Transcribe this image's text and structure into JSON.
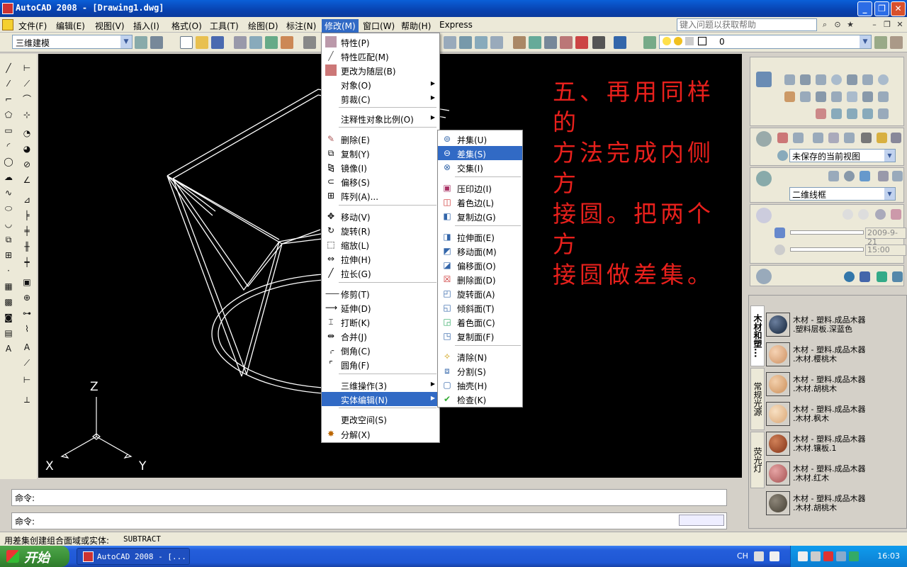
{
  "window": {
    "title": "AutoCAD 2008 - [Drawing1.dwg]",
    "buttons": {
      "minimize": "_",
      "restore": "❐",
      "close": "✕"
    }
  },
  "menubar": {
    "items": [
      "文件(F)",
      "编辑(E)",
      "视图(V)",
      "插入(I)",
      "格式(O)",
      "工具(T)",
      "绘图(D)",
      "标注(N)",
      "修改(M)",
      "窗口(W)",
      "帮助(H)",
      "Express"
    ],
    "active_index": 8,
    "help_search_placeholder": "键入问题以获取帮助"
  },
  "toolbar": {
    "workspace": "三维建模",
    "layer_value": "0"
  },
  "modify_menu": {
    "items": [
      {
        "label": "特性(P)",
        "icon": "properties-icon"
      },
      {
        "label": "特性匹配(M)",
        "icon": "match-properties-icon"
      },
      {
        "label": "更改为随层(B)",
        "icon": "change-to-bylayer-icon"
      },
      {
        "label": "对象(O)",
        "submenu": true
      },
      {
        "label": "剪裁(C)",
        "submenu": true
      },
      {
        "label": "注释性对象比例(O)",
        "submenu": true
      },
      {
        "label": "删除(E)",
        "icon": "erase-icon"
      },
      {
        "label": "复制(Y)",
        "icon": "copy-icon"
      },
      {
        "label": "镜像(I)",
        "icon": "mirror-icon"
      },
      {
        "label": "偏移(S)",
        "icon": "offset-icon"
      },
      {
        "label": "阵列(A)...",
        "icon": "array-icon"
      },
      {
        "label": "移动(V)",
        "icon": "move-icon"
      },
      {
        "label": "旋转(R)",
        "icon": "rotate-icon"
      },
      {
        "label": "缩放(L)",
        "icon": "scale-icon"
      },
      {
        "label": "拉伸(H)",
        "icon": "stretch-icon"
      },
      {
        "label": "拉长(G)",
        "icon": "lengthen-icon"
      },
      {
        "label": "修剪(T)",
        "icon": "trim-icon"
      },
      {
        "label": "延伸(D)",
        "icon": "extend-icon"
      },
      {
        "label": "打断(K)",
        "icon": "break-icon"
      },
      {
        "label": "合并(J)",
        "icon": "join-icon"
      },
      {
        "label": "倒角(C)",
        "icon": "chamfer-icon"
      },
      {
        "label": "圆角(F)",
        "icon": "fillet-icon"
      },
      {
        "label": "三维操作(3)",
        "submenu": true
      },
      {
        "label": "实体编辑(N)",
        "submenu": true,
        "highlighted": true
      },
      {
        "label": "更改空间(S)"
      },
      {
        "label": "分解(X)",
        "icon": "explode-icon"
      }
    ]
  },
  "solid_edit_menu": {
    "items": [
      {
        "label": "并集(U)",
        "icon": "union-icon"
      },
      {
        "label": "差集(S)",
        "icon": "subtract-icon",
        "highlighted": true
      },
      {
        "label": "交集(I)",
        "icon": "intersect-icon"
      },
      {
        "label": "压印边(I)",
        "icon": "imprint-icon"
      },
      {
        "label": "着色边(L)",
        "icon": "color-edges-icon"
      },
      {
        "label": "复制边(G)",
        "icon": "copy-edges-icon"
      },
      {
        "label": "拉伸面(E)",
        "icon": "extrude-faces-icon"
      },
      {
        "label": "移动面(M)",
        "icon": "move-faces-icon"
      },
      {
        "label": "偏移面(O)",
        "icon": "offset-faces-icon"
      },
      {
        "label": "删除面(D)",
        "icon": "delete-faces-icon"
      },
      {
        "label": "旋转面(A)",
        "icon": "rotate-faces-icon"
      },
      {
        "label": "倾斜面(T)",
        "icon": "taper-faces-icon"
      },
      {
        "label": "着色面(C)",
        "icon": "color-faces-icon"
      },
      {
        "label": "复制面(F)",
        "icon": "copy-faces-icon"
      },
      {
        "label": "清除(N)",
        "icon": "clean-icon"
      },
      {
        "label": "分割(S)",
        "icon": "separate-icon"
      },
      {
        "label": "抽壳(H)",
        "icon": "shell-icon"
      },
      {
        "label": "检查(K)",
        "icon": "check-icon"
      }
    ]
  },
  "annotation": {
    "lines": [
      "五、再用同样的",
      "方法完成内侧方",
      "接圆。把两个方",
      "接圆做差集。"
    ],
    "color": "#e8201c"
  },
  "ucs": {
    "x": "X",
    "y": "Y",
    "z": "Z"
  },
  "right_panel": {
    "view_select": "未保存的当前视图",
    "visual_style_select": "二维线框",
    "date_value": "2009-9-21",
    "time_value": "15:00"
  },
  "materials": {
    "tabs": [
      "木材和塑...",
      "常规光源",
      "荧光灯"
    ],
    "items": [
      {
        "line1": "木材 - 塑料.成品木器",
        "line2": ".塑料层板.深蓝色",
        "color": "#2c3d55"
      },
      {
        "line1": "木材 - 塑料.成品木器",
        "line2": ".木材.樱桃木",
        "color": "#d9a47a"
      },
      {
        "line1": "木材 - 塑料.成品木器",
        "line2": ".木材.胡桃木",
        "color": "#d7a272"
      },
      {
        "line1": "木材 - 塑料.成品木器",
        "line2": ".木材.枫木",
        "color": "#e2b78c"
      },
      {
        "line1": "木材 - 塑料.成品木器",
        "line2": ".木材.镶板.1",
        "color": "#9a4a2a"
      },
      {
        "line1": "木材 - 塑料.成品木器",
        "line2": ".木材.红木",
        "color": "#b86a6a"
      },
      {
        "line1": "木材 - 塑料.成品木器",
        "line2": ".木材.胡桃木",
        "color": "#5a5448"
      }
    ]
  },
  "command": {
    "line1": "命令:",
    "line2": "命令:"
  },
  "statusbar": {
    "text": "用差集创建组合面域或实体:",
    "command": "SUBTRACT"
  },
  "taskbar": {
    "start": "开始",
    "task_label": "AutoCAD 2008 - [...",
    "lang": "CH",
    "clock": "16:03"
  }
}
